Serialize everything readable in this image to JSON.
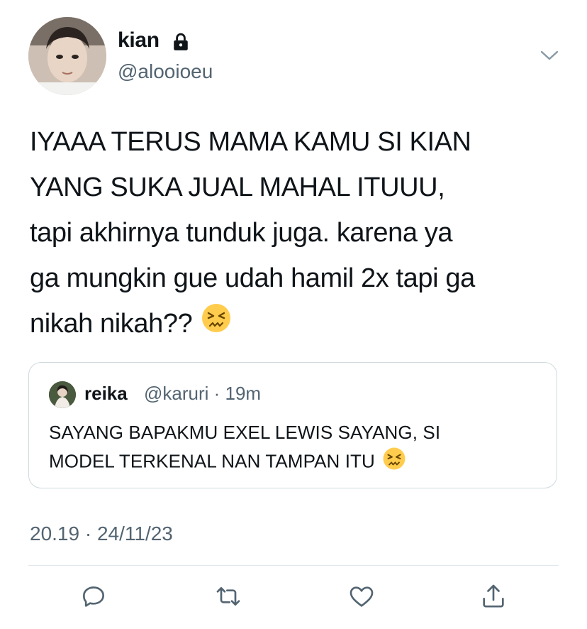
{
  "tweet": {
    "display_name": "kian",
    "handle": "@alooioeu",
    "locked_icon": "lock-icon",
    "more_icon": "chevron-down-icon",
    "text_lines": [
      "IYAAA TERUS MAMA KAMU SI KIAN",
      "YANG SUKA JUAL MAHAL ITUUU,",
      "tapi akhirnya tunduk juga. karena ya",
      "ga mungkin gue udah hamil 2x tapi ga",
      "nikah nikah??"
    ],
    "emoji": "persevering-face-emoji",
    "timestamp": "20.19 · 24/11/23"
  },
  "quoted": {
    "display_name": "reika",
    "handle_time": "@karuri · 19m",
    "text_lines": [
      "SAYANG BAPAKMU EXEL LEWIS SAYANG, SI",
      "MODEL TERKENAL NAN TAMPAN ITU"
    ],
    "emoji": "persevering-face-emoji"
  },
  "actions": [
    {
      "name": "reply",
      "icon": "reply-icon"
    },
    {
      "name": "retweet",
      "icon": "retweet-icon"
    },
    {
      "name": "like",
      "icon": "heart-icon"
    },
    {
      "name": "share",
      "icon": "share-icon"
    }
  ],
  "colors": {
    "text": "#0f1419",
    "secondary": "#536471",
    "border": "#cfd9de",
    "divider": "#e1e8ed"
  }
}
